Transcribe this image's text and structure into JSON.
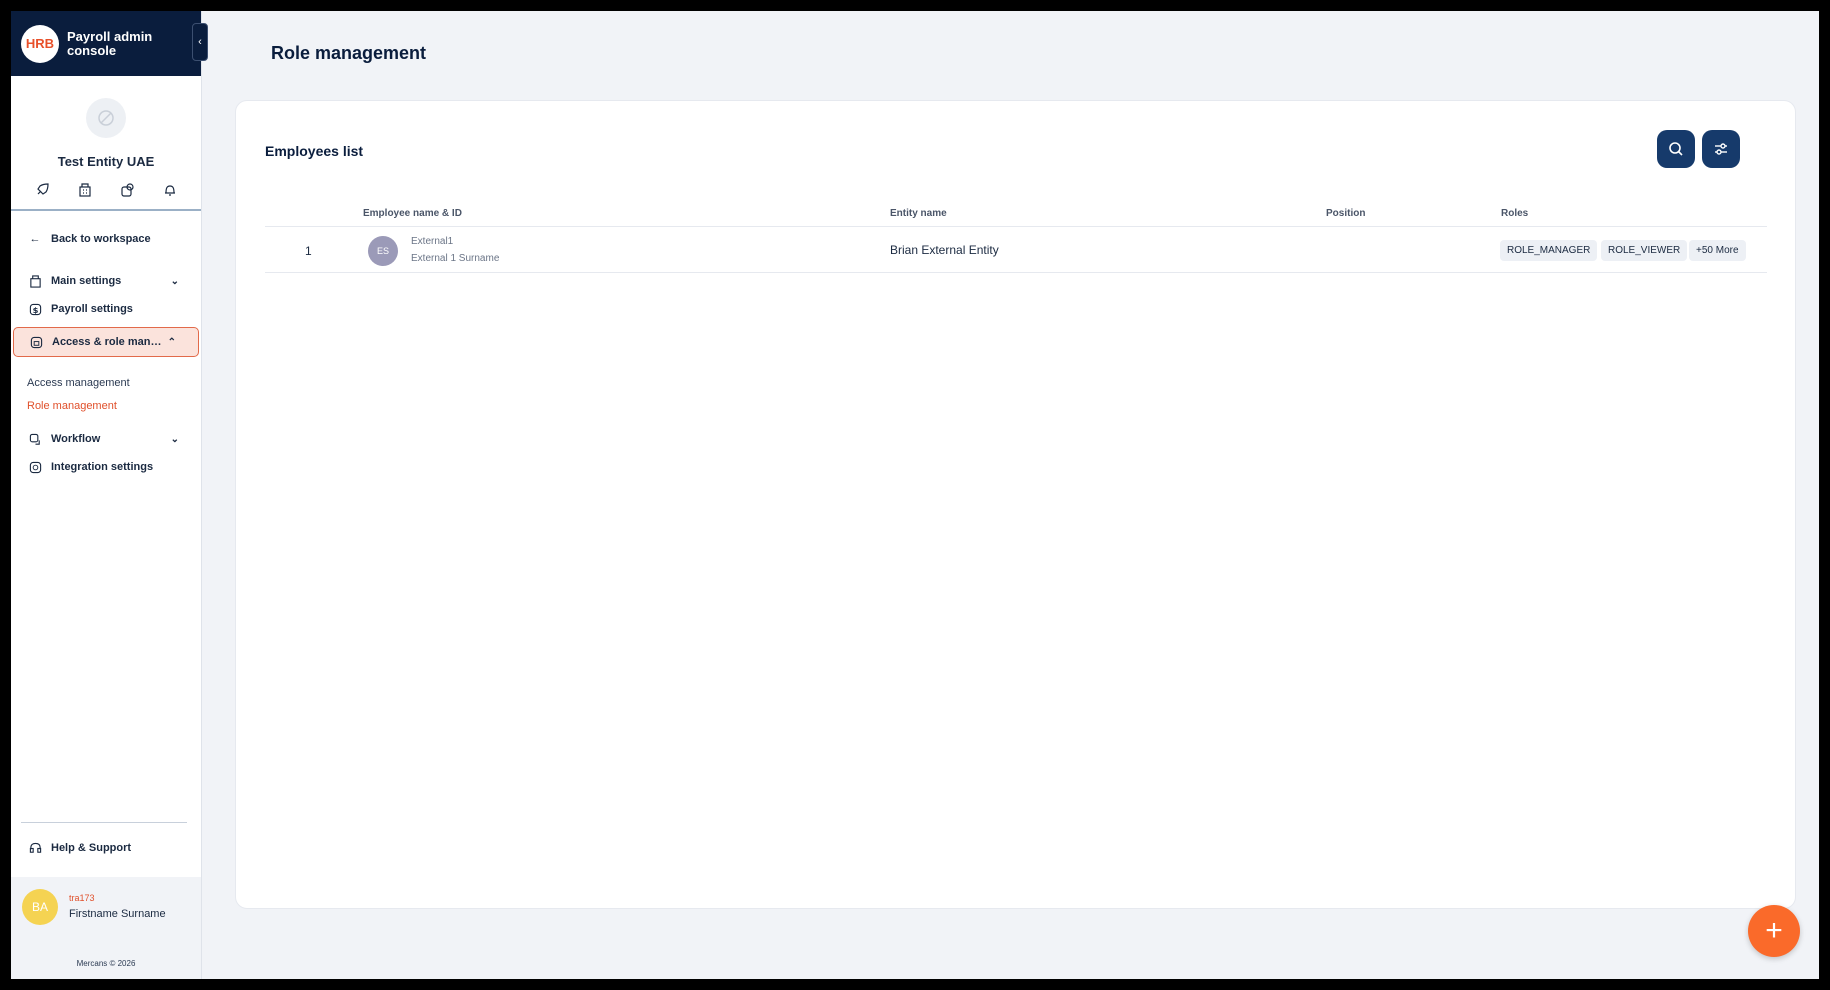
{
  "brand": {
    "logo_text": "HRB",
    "title": "Payroll admin console"
  },
  "entity": {
    "name": "Test Entity UAE"
  },
  "quick_icons": [
    "rocket-icon",
    "building-icon",
    "badge-icon",
    "bell-icon"
  ],
  "nav": {
    "back": "Back to workspace",
    "main_settings": "Main settings",
    "payroll_settings": "Payroll settings",
    "access_role": "Access & role management",
    "access_management": "Access management",
    "role_management": "Role management",
    "workflow": "Workflow",
    "integration_settings": "Integration settings",
    "help": "Help & Support"
  },
  "user": {
    "initials": "BA",
    "id": "tra173",
    "name": "Firstname Surname"
  },
  "copyright": "Mercans © 2026",
  "page": {
    "title": "Role management"
  },
  "card": {
    "title": "Employees list"
  },
  "table": {
    "headers": {
      "employee": "Employee name & ID",
      "entity": "Entity name",
      "position": "Position",
      "roles": "Roles"
    },
    "rows": [
      {
        "num": "1",
        "initials": "ES",
        "line1": "External1",
        "line2": "External 1 Surname",
        "entity": "Brian External Entity",
        "position": "",
        "roles": [
          "ROLE_MANAGER",
          "ROLE_VIEWER"
        ],
        "more": "+50 More"
      }
    ]
  },
  "colors": {
    "brand_navy": "#0a1d3d",
    "accent_orange": "#fa6a2a",
    "active_bg": "#fbe3dc"
  }
}
